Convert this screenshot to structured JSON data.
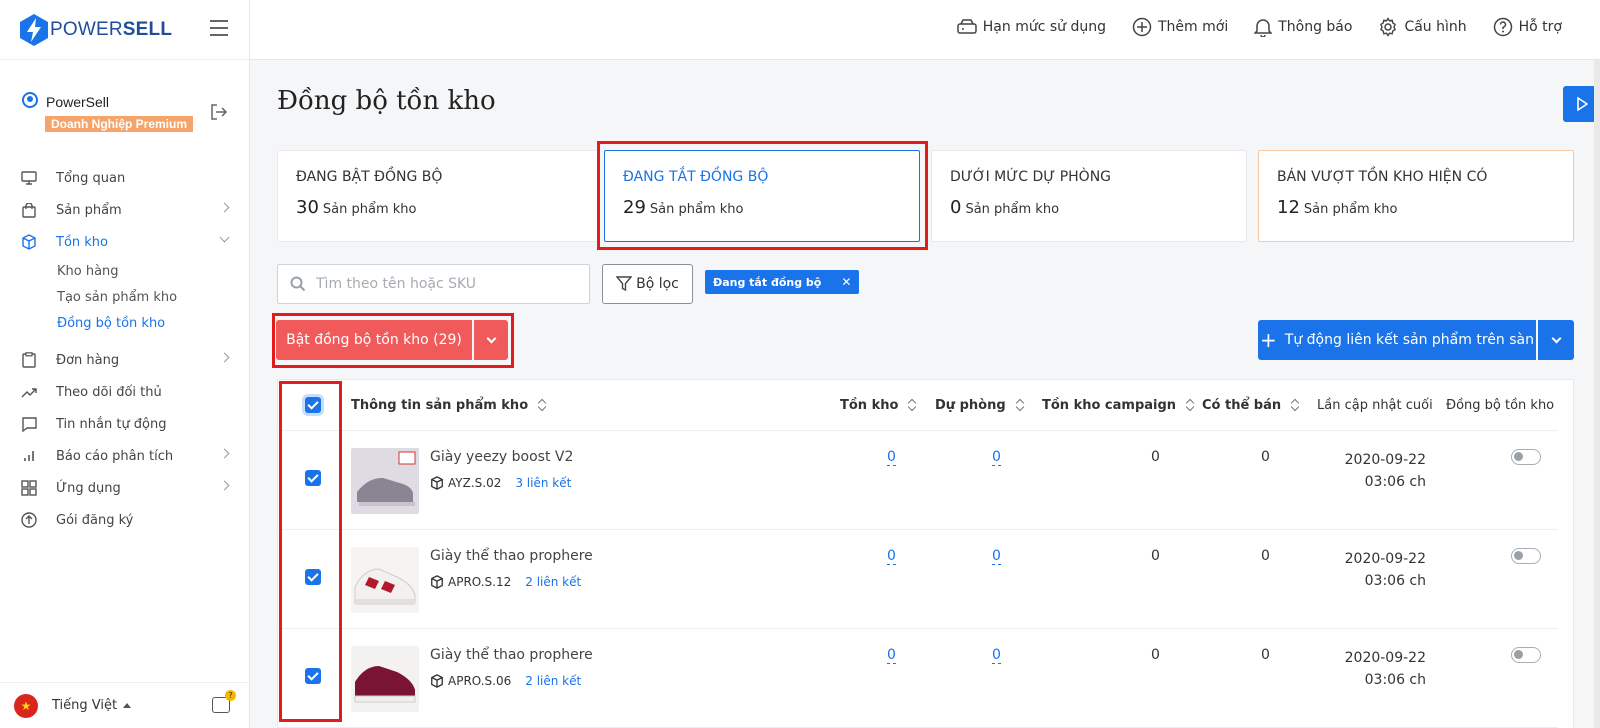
{
  "brand": {
    "name_prefix": "POWER",
    "name_suffix": "SELL"
  },
  "user": {
    "name": "PowerSell",
    "plan": "Doanh Nghiệp Premium"
  },
  "nav": {
    "items": [
      {
        "label": "Tổng quan"
      },
      {
        "label": "Sản phẩm"
      },
      {
        "label": "Tồn kho"
      },
      {
        "label": "Đơn hàng"
      },
      {
        "label": "Theo dõi đối thủ"
      },
      {
        "label": "Tin nhắn tự động"
      },
      {
        "label": "Báo cáo phân tích"
      },
      {
        "label": "Ứng dụng"
      },
      {
        "label": "Gói đăng ký"
      }
    ],
    "sub_items": [
      {
        "label": "Kho hàng"
      },
      {
        "label": "Tạo sản phẩm kho"
      },
      {
        "label": "Đồng bộ tồn kho"
      }
    ]
  },
  "footer": {
    "language": "Tiếng Việt"
  },
  "topbar": {
    "links": [
      {
        "label": "Hạn mức sử dụng",
        "icon": "usage-icon"
      },
      {
        "label": "Thêm mới",
        "icon": "plus-circle-icon"
      },
      {
        "label": "Thông báo",
        "icon": "bell-icon"
      },
      {
        "label": "Cấu hình",
        "icon": "gear-icon"
      },
      {
        "label": "Hỗ trợ",
        "icon": "help-icon"
      }
    ]
  },
  "page": {
    "title": "Đồng bộ tồn kho"
  },
  "cards": [
    {
      "title": "ĐANG BẬT ĐỒNG BỘ",
      "count": "30",
      "unit": "Sản phẩm kho"
    },
    {
      "title": "ĐANG TẮT ĐỒNG BỘ",
      "count": "29",
      "unit": "Sản phẩm kho"
    },
    {
      "title": "DƯỚI MỨC DỰ PHÒNG",
      "count": "0",
      "unit": "Sản phẩm kho"
    },
    {
      "title": "BÁN VƯỢT TỒN KHO HIỆN CÓ",
      "count": "12",
      "unit": "Sản phẩm kho"
    }
  ],
  "search": {
    "placeholder": "Tìm theo tên hoặc SKU"
  },
  "filter": {
    "label": "Bộ lọc",
    "active_tag": "Đang tắt đồng bộ",
    "tag_close": "✕"
  },
  "actions": {
    "sync_on": "Bật đồng bộ tồn kho (29)",
    "auto_link": "Tự động liên kết sản phẩm trên sàn",
    "plus": "+"
  },
  "table": {
    "headers": {
      "product": "Thông tin sản phẩm kho",
      "stock": "Tồn kho",
      "reserve": "Dự phòng",
      "campaign": "Tồn kho campaign",
      "sellable": "Có thể bán",
      "updated": "Lần cập nhật cuối",
      "sync": "Đồng bộ tồn kho"
    },
    "rows": [
      {
        "name": "Giày yeezy boost V2",
        "sku": "AYZ.S.02",
        "links": "3 liên kết",
        "stock": "0",
        "reserve": "0",
        "campaign": "0",
        "sellable": "0",
        "date": "2020-09-22",
        "time": "03:06 ch",
        "colors": [
          "#8b8493",
          "#c9c3cf"
        ]
      },
      {
        "name": "Giày thể thao prophere",
        "sku": "APRO.S.12",
        "links": "2 liên kết",
        "stock": "0",
        "reserve": "0",
        "campaign": "0",
        "sellable": "0",
        "date": "2020-09-22",
        "time": "03:06 ch",
        "colors": [
          "#b3192b",
          "#f3f1f0"
        ]
      },
      {
        "name": "Giày thể thao prophere",
        "sku": "APRO.S.06",
        "links": "2 liên kết",
        "stock": "0",
        "reserve": "0",
        "campaign": "0",
        "sellable": "0",
        "date": "2020-09-22",
        "time": "03:06 ch",
        "colors": [
          "#7a1433",
          "#f1efee"
        ]
      }
    ]
  }
}
